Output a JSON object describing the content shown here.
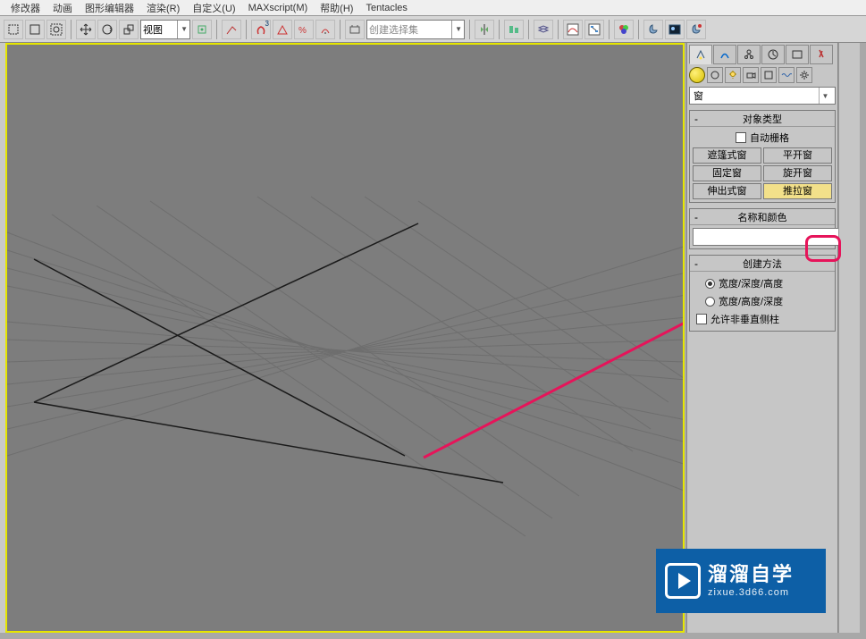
{
  "menubar": {
    "items": [
      "修改器",
      "动画",
      "图形编辑器",
      "渲染(R)",
      "自定义(U)",
      "MAXscript(M)",
      "帮助(H)",
      "Tentacles"
    ]
  },
  "toolbar": {
    "view_dd": "视图",
    "sel_dd": "创建选择集"
  },
  "cmdpanel": {
    "category_dd": "窗",
    "rollout_objtype": {
      "title": "对象类型",
      "autogrid": "自动栅格",
      "btns": [
        "遮篷式窗",
        "平开窗",
        "固定窗",
        "旋开窗",
        "伸出式窗",
        "推拉窗"
      ],
      "active_index": 5
    },
    "rollout_namecolor": {
      "title": "名称和颜色",
      "name_value": "",
      "swatch_color": "#d7f68a"
    },
    "rollout_create": {
      "title": "创建方法",
      "r1": "宽度/深度/高度",
      "r2": "宽度/高度/深度",
      "r_selected": 0,
      "allow": "允许非垂直侧柱"
    }
  },
  "watermark": {
    "big": "溜溜自学",
    "small": "zixue.3d66.com"
  },
  "colors": {
    "highlight_border": "#e6e600",
    "annotation": "#e6145a"
  }
}
